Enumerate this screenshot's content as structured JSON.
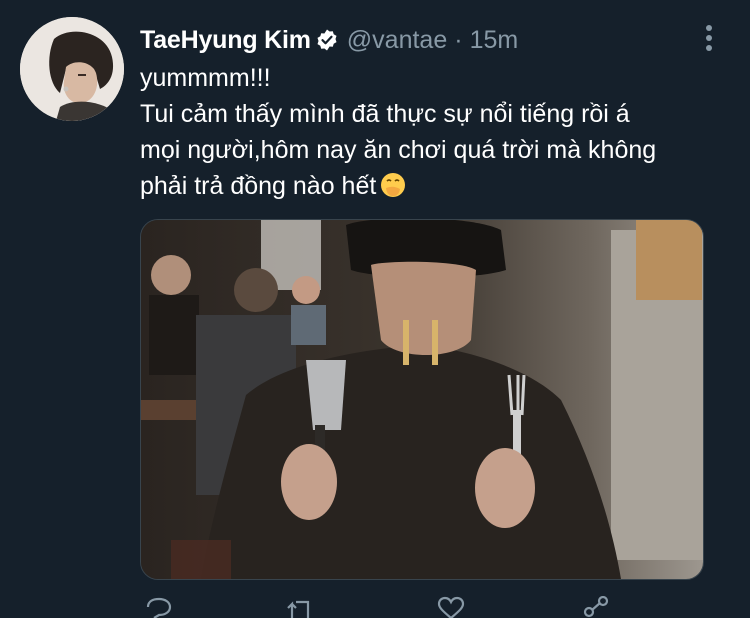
{
  "tweet": {
    "author_name": "TaeHyung Kim",
    "handle": "@vantae",
    "separator": "·",
    "timestamp": "15m",
    "verified": true,
    "text_lines": [
      "yummmm!!!",
      "Tui cảm thấy mình đã thực sự nổi tiếng rồi á",
      "mọi người,hôm nay ăn chơi quá trời mà không",
      "phải trả đồng nào hết"
    ],
    "emoji": "face-with-hand-over-mouth",
    "media": {
      "description_icon": "photo",
      "kind": "photo"
    }
  },
  "actions": [
    "reply-icon",
    "retweet-icon",
    "like-icon",
    "share-icon"
  ],
  "colors": {
    "background": "#15202b",
    "secondary_text": "#8899a6",
    "verified": "#ffffff"
  }
}
